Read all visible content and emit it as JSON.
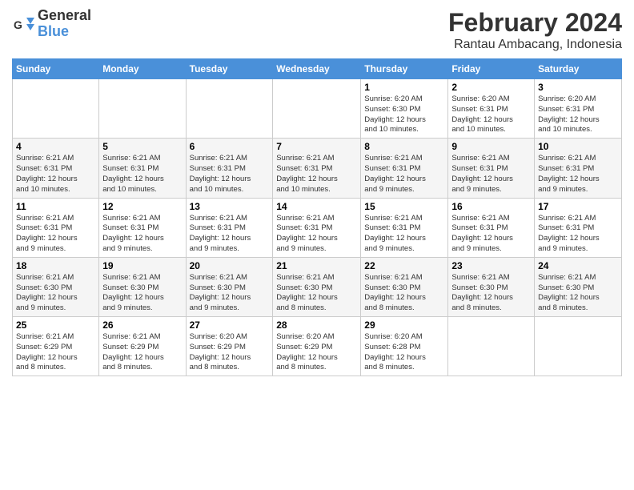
{
  "header": {
    "logo_general": "General",
    "logo_blue": "Blue",
    "month_year": "February 2024",
    "location": "Rantau Ambacang, Indonesia"
  },
  "days_of_week": [
    "Sunday",
    "Monday",
    "Tuesday",
    "Wednesday",
    "Thursday",
    "Friday",
    "Saturday"
  ],
  "weeks": [
    [
      {
        "day": "",
        "info": ""
      },
      {
        "day": "",
        "info": ""
      },
      {
        "day": "",
        "info": ""
      },
      {
        "day": "",
        "info": ""
      },
      {
        "day": "1",
        "info": "Sunrise: 6:20 AM\nSunset: 6:30 PM\nDaylight: 12 hours\nand 10 minutes."
      },
      {
        "day": "2",
        "info": "Sunrise: 6:20 AM\nSunset: 6:31 PM\nDaylight: 12 hours\nand 10 minutes."
      },
      {
        "day": "3",
        "info": "Sunrise: 6:20 AM\nSunset: 6:31 PM\nDaylight: 12 hours\nand 10 minutes."
      }
    ],
    [
      {
        "day": "4",
        "info": "Sunrise: 6:21 AM\nSunset: 6:31 PM\nDaylight: 12 hours\nand 10 minutes."
      },
      {
        "day": "5",
        "info": "Sunrise: 6:21 AM\nSunset: 6:31 PM\nDaylight: 12 hours\nand 10 minutes."
      },
      {
        "day": "6",
        "info": "Sunrise: 6:21 AM\nSunset: 6:31 PM\nDaylight: 12 hours\nand 10 minutes."
      },
      {
        "day": "7",
        "info": "Sunrise: 6:21 AM\nSunset: 6:31 PM\nDaylight: 12 hours\nand 10 minutes."
      },
      {
        "day": "8",
        "info": "Sunrise: 6:21 AM\nSunset: 6:31 PM\nDaylight: 12 hours\nand 9 minutes."
      },
      {
        "day": "9",
        "info": "Sunrise: 6:21 AM\nSunset: 6:31 PM\nDaylight: 12 hours\nand 9 minutes."
      },
      {
        "day": "10",
        "info": "Sunrise: 6:21 AM\nSunset: 6:31 PM\nDaylight: 12 hours\nand 9 minutes."
      }
    ],
    [
      {
        "day": "11",
        "info": "Sunrise: 6:21 AM\nSunset: 6:31 PM\nDaylight: 12 hours\nand 9 minutes."
      },
      {
        "day": "12",
        "info": "Sunrise: 6:21 AM\nSunset: 6:31 PM\nDaylight: 12 hours\nand 9 minutes."
      },
      {
        "day": "13",
        "info": "Sunrise: 6:21 AM\nSunset: 6:31 PM\nDaylight: 12 hours\nand 9 minutes."
      },
      {
        "day": "14",
        "info": "Sunrise: 6:21 AM\nSunset: 6:31 PM\nDaylight: 12 hours\nand 9 minutes."
      },
      {
        "day": "15",
        "info": "Sunrise: 6:21 AM\nSunset: 6:31 PM\nDaylight: 12 hours\nand 9 minutes."
      },
      {
        "day": "16",
        "info": "Sunrise: 6:21 AM\nSunset: 6:31 PM\nDaylight: 12 hours\nand 9 minutes."
      },
      {
        "day": "17",
        "info": "Sunrise: 6:21 AM\nSunset: 6:31 PM\nDaylight: 12 hours\nand 9 minutes."
      }
    ],
    [
      {
        "day": "18",
        "info": "Sunrise: 6:21 AM\nSunset: 6:30 PM\nDaylight: 12 hours\nand 9 minutes."
      },
      {
        "day": "19",
        "info": "Sunrise: 6:21 AM\nSunset: 6:30 PM\nDaylight: 12 hours\nand 9 minutes."
      },
      {
        "day": "20",
        "info": "Sunrise: 6:21 AM\nSunset: 6:30 PM\nDaylight: 12 hours\nand 9 minutes."
      },
      {
        "day": "21",
        "info": "Sunrise: 6:21 AM\nSunset: 6:30 PM\nDaylight: 12 hours\nand 8 minutes."
      },
      {
        "day": "22",
        "info": "Sunrise: 6:21 AM\nSunset: 6:30 PM\nDaylight: 12 hours\nand 8 minutes."
      },
      {
        "day": "23",
        "info": "Sunrise: 6:21 AM\nSunset: 6:30 PM\nDaylight: 12 hours\nand 8 minutes."
      },
      {
        "day": "24",
        "info": "Sunrise: 6:21 AM\nSunset: 6:30 PM\nDaylight: 12 hours\nand 8 minutes."
      }
    ],
    [
      {
        "day": "25",
        "info": "Sunrise: 6:21 AM\nSunset: 6:29 PM\nDaylight: 12 hours\nand 8 minutes."
      },
      {
        "day": "26",
        "info": "Sunrise: 6:21 AM\nSunset: 6:29 PM\nDaylight: 12 hours\nand 8 minutes."
      },
      {
        "day": "27",
        "info": "Sunrise: 6:20 AM\nSunset: 6:29 PM\nDaylight: 12 hours\nand 8 minutes."
      },
      {
        "day": "28",
        "info": "Sunrise: 6:20 AM\nSunset: 6:29 PM\nDaylight: 12 hours\nand 8 minutes."
      },
      {
        "day": "29",
        "info": "Sunrise: 6:20 AM\nSunset: 6:28 PM\nDaylight: 12 hours\nand 8 minutes."
      },
      {
        "day": "",
        "info": ""
      },
      {
        "day": "",
        "info": ""
      }
    ]
  ]
}
